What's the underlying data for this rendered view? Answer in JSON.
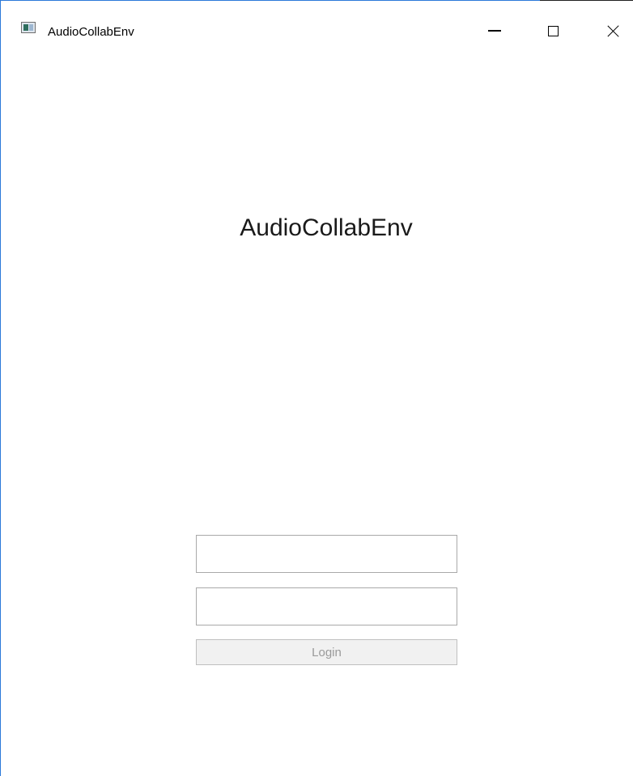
{
  "window": {
    "title": "AudioCollabEnv",
    "icon": "app-window-icon",
    "controls": {
      "minimize_icon": "minimize-icon",
      "maximize_icon": "maximize-icon",
      "close_icon": "close-icon"
    }
  },
  "main": {
    "heading": "AudioCollabEnv"
  },
  "login_form": {
    "username": {
      "value": "",
      "placeholder": ""
    },
    "password": {
      "value": "",
      "placeholder": ""
    },
    "login_label": "Login",
    "login_enabled": false
  },
  "colors": {
    "window_border": "#2b79d9",
    "disabled_button_bg": "#f1f1f1",
    "disabled_button_text": "#9a9a9a"
  }
}
